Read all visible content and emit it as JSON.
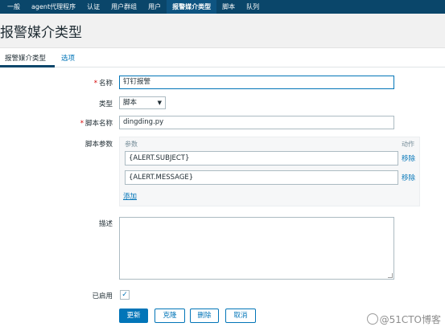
{
  "nav": {
    "items": [
      {
        "label": "一般"
      },
      {
        "label": "agent代理程序"
      },
      {
        "label": "认证"
      },
      {
        "label": "用户群组"
      },
      {
        "label": "用户"
      },
      {
        "label": "报警媒介类型",
        "active": true
      },
      {
        "label": "脚本"
      },
      {
        "label": "队列"
      }
    ]
  },
  "header": {
    "title": "报警媒介类型"
  },
  "tabs": [
    {
      "label": "报警媒介类型",
      "active": true
    },
    {
      "label": "选项",
      "active": false
    }
  ],
  "form": {
    "required_mark": "*",
    "name": {
      "label": "名称",
      "value": "钉钉报警"
    },
    "type": {
      "label": "类型",
      "value": "脚本"
    },
    "script_name": {
      "label": "脚本名称",
      "value": "dingding.py"
    },
    "script_params": {
      "label": "脚本参数",
      "col_param": "参数",
      "col_action": "动作",
      "rows": [
        {
          "value": "{ALERT.SUBJECT}",
          "remove": "移除"
        },
        {
          "value": "{ALERT.MESSAGE}",
          "remove": "移除"
        }
      ],
      "add": "添加"
    },
    "description": {
      "label": "描述",
      "value": ""
    },
    "enabled": {
      "label": "已启用",
      "checked": true,
      "check_glyph": "✓"
    }
  },
  "buttons": {
    "update": "更新",
    "clone": "克隆",
    "delete": "删除",
    "cancel": "取消"
  },
  "watermark": {
    "text": "@51CTO博客"
  },
  "colors": {
    "nav_bg": "#0a466a",
    "accent": "#0275b8",
    "header_bg": "#f1f1f1"
  }
}
